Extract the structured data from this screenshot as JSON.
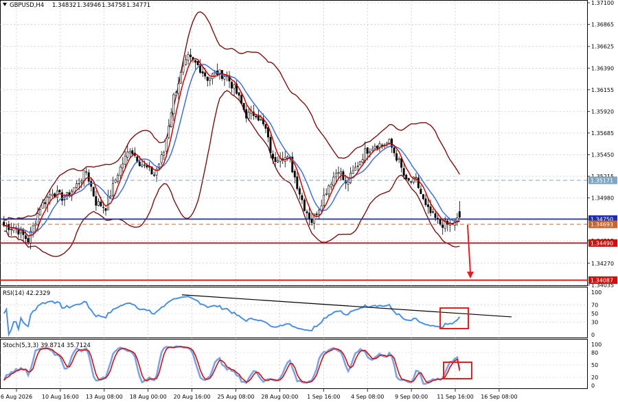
{
  "chart_data": {
    "type": "candlestick",
    "symbol": "GBPUSD,H4",
    "header_values": [
      "1.34832",
      "1.34946",
      "1.34758",
      "1.34771"
    ],
    "price_axis": {
      "range": [
        1.34045,
        1.371
      ],
      "tick_labels": [
        "1.37100",
        "1.36865",
        "1.36625",
        "1.36390",
        "1.36155",
        "1.35920",
        "1.35685",
        "1.35450",
        "1.35215",
        "1.34980",
        "1.34750",
        "1.34515",
        "1.34270",
        "1.34035"
      ]
    },
    "time_axis": {
      "labels": [
        "6 Aug 2026",
        "10 Aug 16:00",
        "13 Aug 08:00",
        "18 Aug 00:00",
        "20 Aug 16:00",
        "25 Aug 08:00",
        "28 Aug 00:00",
        "1 Sep 16:00",
        "4 Sep 08:00",
        "9 Sep 00:00",
        "11 Sep 16:00",
        "16 Sep 08:00"
      ]
    },
    "levels": [
      {
        "price": 1.35171,
        "label": "1.35171",
        "color": "#7fa7c4",
        "style": "dashed"
      },
      {
        "price": 1.3475,
        "label": "1.34750",
        "color": "#1f2fa8",
        "style": "solid"
      },
      {
        "price": 1.34693,
        "label": "1.34693",
        "color": "#c8642d",
        "style": "dashed"
      },
      {
        "price": 1.3449,
        "label": "1.34490",
        "color": "#cc1111",
        "style": "solid"
      },
      {
        "price": 1.34087,
        "label": "1.34087",
        "color": "#cc1111",
        "style": "solid"
      }
    ],
    "close_path": [
      [
        0,
        1.3468
      ],
      [
        5,
        1.3465
      ],
      [
        10,
        1.3452
      ],
      [
        15,
        1.3488
      ],
      [
        20,
        1.3505
      ],
      [
        25,
        1.3497
      ],
      [
        30,
        1.3512
      ],
      [
        34,
        1.3527
      ],
      [
        38,
        1.3493
      ],
      [
        42,
        1.3488
      ],
      [
        47,
        1.3525
      ],
      [
        52,
        1.3552
      ],
      [
        56,
        1.3537
      ],
      [
        62,
        1.3523
      ],
      [
        66,
        1.3548
      ],
      [
        70,
        1.3608
      ],
      [
        73,
        1.3632
      ],
      [
        76,
        1.365
      ],
      [
        80,
        1.3642
      ],
      [
        84,
        1.3628
      ],
      [
        88,
        1.3634
      ],
      [
        92,
        1.363
      ],
      [
        96,
        1.3612
      ],
      [
        100,
        1.3588
      ],
      [
        104,
        1.359
      ],
      [
        108,
        1.3572
      ],
      [
        111,
        1.3538
      ],
      [
        114,
        1.3545
      ],
      [
        118,
        1.3538
      ],
      [
        121,
        1.3512
      ],
      [
        124,
        1.3488
      ],
      [
        127,
        1.3473
      ],
      [
        130,
        1.3488
      ],
      [
        134,
        1.3512
      ],
      [
        138,
        1.353
      ],
      [
        141,
        1.3512
      ],
      [
        145,
        1.353
      ],
      [
        149,
        1.3548
      ],
      [
        153,
        1.3556
      ],
      [
        156,
        1.3556
      ],
      [
        159,
        1.3558
      ],
      [
        163,
        1.3537
      ],
      [
        166,
        1.3515
      ],
      [
        170,
        1.3517
      ],
      [
        174,
        1.3488
      ],
      [
        177,
        1.3478
      ],
      [
        180,
        1.347
      ],
      [
        183,
        1.3469
      ],
      [
        186,
        1.3471
      ],
      [
        188,
        1.3477
      ]
    ],
    "indicators": {
      "rsi": {
        "label": "RSI(14) 42.2329",
        "period": 14,
        "value": 42.2329,
        "range": [
          0,
          100
        ],
        "tick_labels": [
          "100",
          "70",
          "50",
          "30",
          "0"
        ]
      },
      "stochastic": {
        "label": "Stoch(5,3,3) 39.8714 35.7124",
        "params": [
          5,
          3,
          3
        ],
        "values": [
          39.8714,
          35.7124
        ],
        "range": [
          0,
          100
        ],
        "tick_labels": [
          "100",
          "80",
          "50",
          "20",
          "0"
        ]
      }
    },
    "colors": {
      "up": "#000000",
      "down": "#000000",
      "ma_fast": "#cc0000",
      "ma_slow": "#3f6fd6",
      "bands": "#7a1010",
      "rsi": "#4a90e2",
      "stoch_main": "#7ea2e6",
      "stoch_signal": "#cc1111",
      "trendline": "#000000",
      "highlight": "#e02020"
    }
  }
}
